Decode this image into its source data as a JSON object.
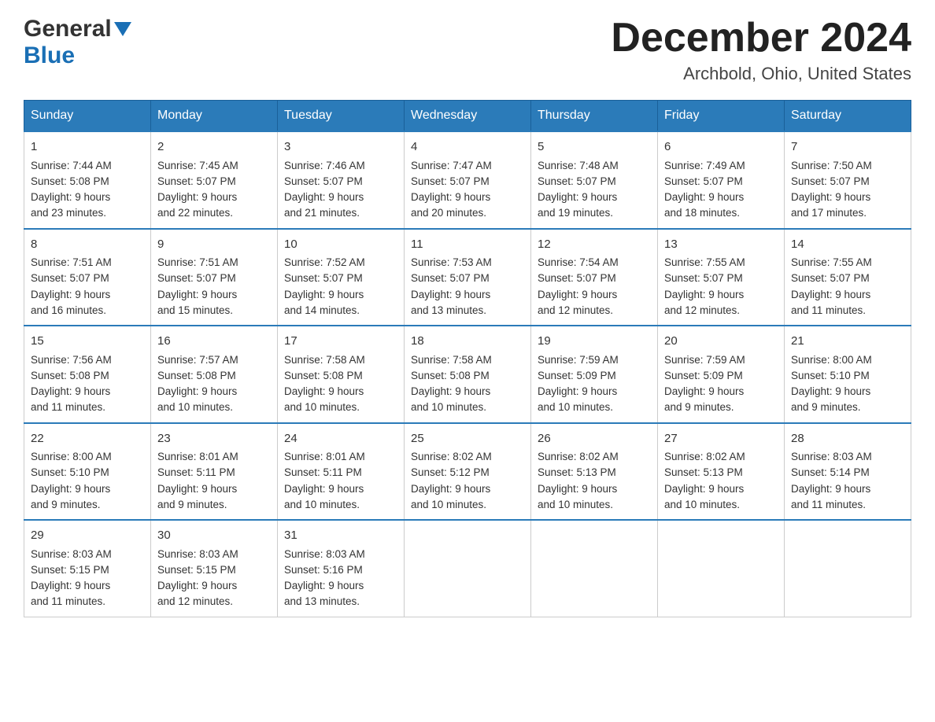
{
  "logo": {
    "general": "General",
    "blue": "Blue",
    "arrow": "▼"
  },
  "header": {
    "month": "December 2024",
    "location": "Archbold, Ohio, United States"
  },
  "days": [
    "Sunday",
    "Monday",
    "Tuesday",
    "Wednesday",
    "Thursday",
    "Friday",
    "Saturday"
  ],
  "weeks": [
    [
      {
        "num": "1",
        "sunrise": "7:44 AM",
        "sunset": "5:08 PM",
        "daylight": "9 hours and 23 minutes."
      },
      {
        "num": "2",
        "sunrise": "7:45 AM",
        "sunset": "5:07 PM",
        "daylight": "9 hours and 22 minutes."
      },
      {
        "num": "3",
        "sunrise": "7:46 AM",
        "sunset": "5:07 PM",
        "daylight": "9 hours and 21 minutes."
      },
      {
        "num": "4",
        "sunrise": "7:47 AM",
        "sunset": "5:07 PM",
        "daylight": "9 hours and 20 minutes."
      },
      {
        "num": "5",
        "sunrise": "7:48 AM",
        "sunset": "5:07 PM",
        "daylight": "9 hours and 19 minutes."
      },
      {
        "num": "6",
        "sunrise": "7:49 AM",
        "sunset": "5:07 PM",
        "daylight": "9 hours and 18 minutes."
      },
      {
        "num": "7",
        "sunrise": "7:50 AM",
        "sunset": "5:07 PM",
        "daylight": "9 hours and 17 minutes."
      }
    ],
    [
      {
        "num": "8",
        "sunrise": "7:51 AM",
        "sunset": "5:07 PM",
        "daylight": "9 hours and 16 minutes."
      },
      {
        "num": "9",
        "sunrise": "7:51 AM",
        "sunset": "5:07 PM",
        "daylight": "9 hours and 15 minutes."
      },
      {
        "num": "10",
        "sunrise": "7:52 AM",
        "sunset": "5:07 PM",
        "daylight": "9 hours and 14 minutes."
      },
      {
        "num": "11",
        "sunrise": "7:53 AM",
        "sunset": "5:07 PM",
        "daylight": "9 hours and 13 minutes."
      },
      {
        "num": "12",
        "sunrise": "7:54 AM",
        "sunset": "5:07 PM",
        "daylight": "9 hours and 12 minutes."
      },
      {
        "num": "13",
        "sunrise": "7:55 AM",
        "sunset": "5:07 PM",
        "daylight": "9 hours and 12 minutes."
      },
      {
        "num": "14",
        "sunrise": "7:55 AM",
        "sunset": "5:07 PM",
        "daylight": "9 hours and 11 minutes."
      }
    ],
    [
      {
        "num": "15",
        "sunrise": "7:56 AM",
        "sunset": "5:08 PM",
        "daylight": "9 hours and 11 minutes."
      },
      {
        "num": "16",
        "sunrise": "7:57 AM",
        "sunset": "5:08 PM",
        "daylight": "9 hours and 10 minutes."
      },
      {
        "num": "17",
        "sunrise": "7:58 AM",
        "sunset": "5:08 PM",
        "daylight": "9 hours and 10 minutes."
      },
      {
        "num": "18",
        "sunrise": "7:58 AM",
        "sunset": "5:08 PM",
        "daylight": "9 hours and 10 minutes."
      },
      {
        "num": "19",
        "sunrise": "7:59 AM",
        "sunset": "5:09 PM",
        "daylight": "9 hours and 10 minutes."
      },
      {
        "num": "20",
        "sunrise": "7:59 AM",
        "sunset": "5:09 PM",
        "daylight": "9 hours and 9 minutes."
      },
      {
        "num": "21",
        "sunrise": "8:00 AM",
        "sunset": "5:10 PM",
        "daylight": "9 hours and 9 minutes."
      }
    ],
    [
      {
        "num": "22",
        "sunrise": "8:00 AM",
        "sunset": "5:10 PM",
        "daylight": "9 hours and 9 minutes."
      },
      {
        "num": "23",
        "sunrise": "8:01 AM",
        "sunset": "5:11 PM",
        "daylight": "9 hours and 9 minutes."
      },
      {
        "num": "24",
        "sunrise": "8:01 AM",
        "sunset": "5:11 PM",
        "daylight": "9 hours and 10 minutes."
      },
      {
        "num": "25",
        "sunrise": "8:02 AM",
        "sunset": "5:12 PM",
        "daylight": "9 hours and 10 minutes."
      },
      {
        "num": "26",
        "sunrise": "8:02 AM",
        "sunset": "5:13 PM",
        "daylight": "9 hours and 10 minutes."
      },
      {
        "num": "27",
        "sunrise": "8:02 AM",
        "sunset": "5:13 PM",
        "daylight": "9 hours and 10 minutes."
      },
      {
        "num": "28",
        "sunrise": "8:03 AM",
        "sunset": "5:14 PM",
        "daylight": "9 hours and 11 minutes."
      }
    ],
    [
      {
        "num": "29",
        "sunrise": "8:03 AM",
        "sunset": "5:15 PM",
        "daylight": "9 hours and 11 minutes."
      },
      {
        "num": "30",
        "sunrise": "8:03 AM",
        "sunset": "5:15 PM",
        "daylight": "9 hours and 12 minutes."
      },
      {
        "num": "31",
        "sunrise": "8:03 AM",
        "sunset": "5:16 PM",
        "daylight": "9 hours and 13 minutes."
      },
      null,
      null,
      null,
      null
    ]
  ],
  "labels": {
    "sunrise": "Sunrise:",
    "sunset": "Sunset:",
    "daylight": "Daylight:"
  }
}
